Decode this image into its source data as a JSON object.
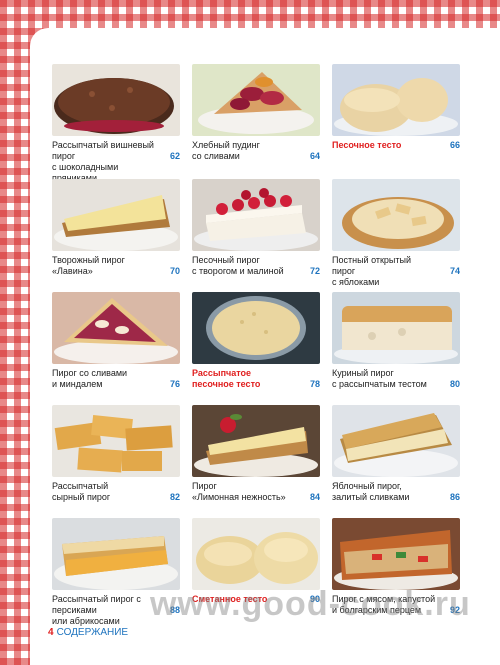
{
  "footer": {
    "page_number": "4",
    "section": "СОДЕРЖАНИЕ"
  },
  "watermark": "www.good-cook.ru",
  "items": [
    {
      "title": "Рассыпчатый вишневый пирог\nс шоколадными пряниками",
      "page": "62",
      "highlight": false
    },
    {
      "title": "Хлебный пудинг\nсо сливами",
      "page": "64",
      "highlight": false
    },
    {
      "title": "Песочное тесто",
      "page": "66",
      "highlight": true
    },
    {
      "title": "Творожный пирог\n«Лавина»",
      "page": "70",
      "highlight": false
    },
    {
      "title": "Песочный пирог\nс творогом и малиной",
      "page": "72",
      "highlight": false
    },
    {
      "title": "Постный открытый пирог\nс яблоками",
      "page": "74",
      "highlight": false
    },
    {
      "title": "Пирог со сливами\nи миндалем",
      "page": "76",
      "highlight": false
    },
    {
      "title": "Рассыпчатое\nпесочное тесто",
      "page": "78",
      "highlight": true
    },
    {
      "title": "Куриный пирог\nс рассыпчатым тестом",
      "page": "80",
      "highlight": false
    },
    {
      "title": "Рассыпчатый\nсырный пирог",
      "page": "82",
      "highlight": false
    },
    {
      "title": "Пирог\n«Лимонная нежность»",
      "page": "84",
      "highlight": false
    },
    {
      "title": "Яблочный пирог,\nзалитый сливками",
      "page": "86",
      "highlight": false
    },
    {
      "title": "Рассыпчатый пирог с персиками\nили абрикосами",
      "page": "88",
      "highlight": false
    },
    {
      "title": "Сметанное тесто",
      "page": "90",
      "highlight": true
    },
    {
      "title": "Пирог с мясом, капустой\nи болгарским перцем",
      "page": "92",
      "highlight": false
    }
  ]
}
